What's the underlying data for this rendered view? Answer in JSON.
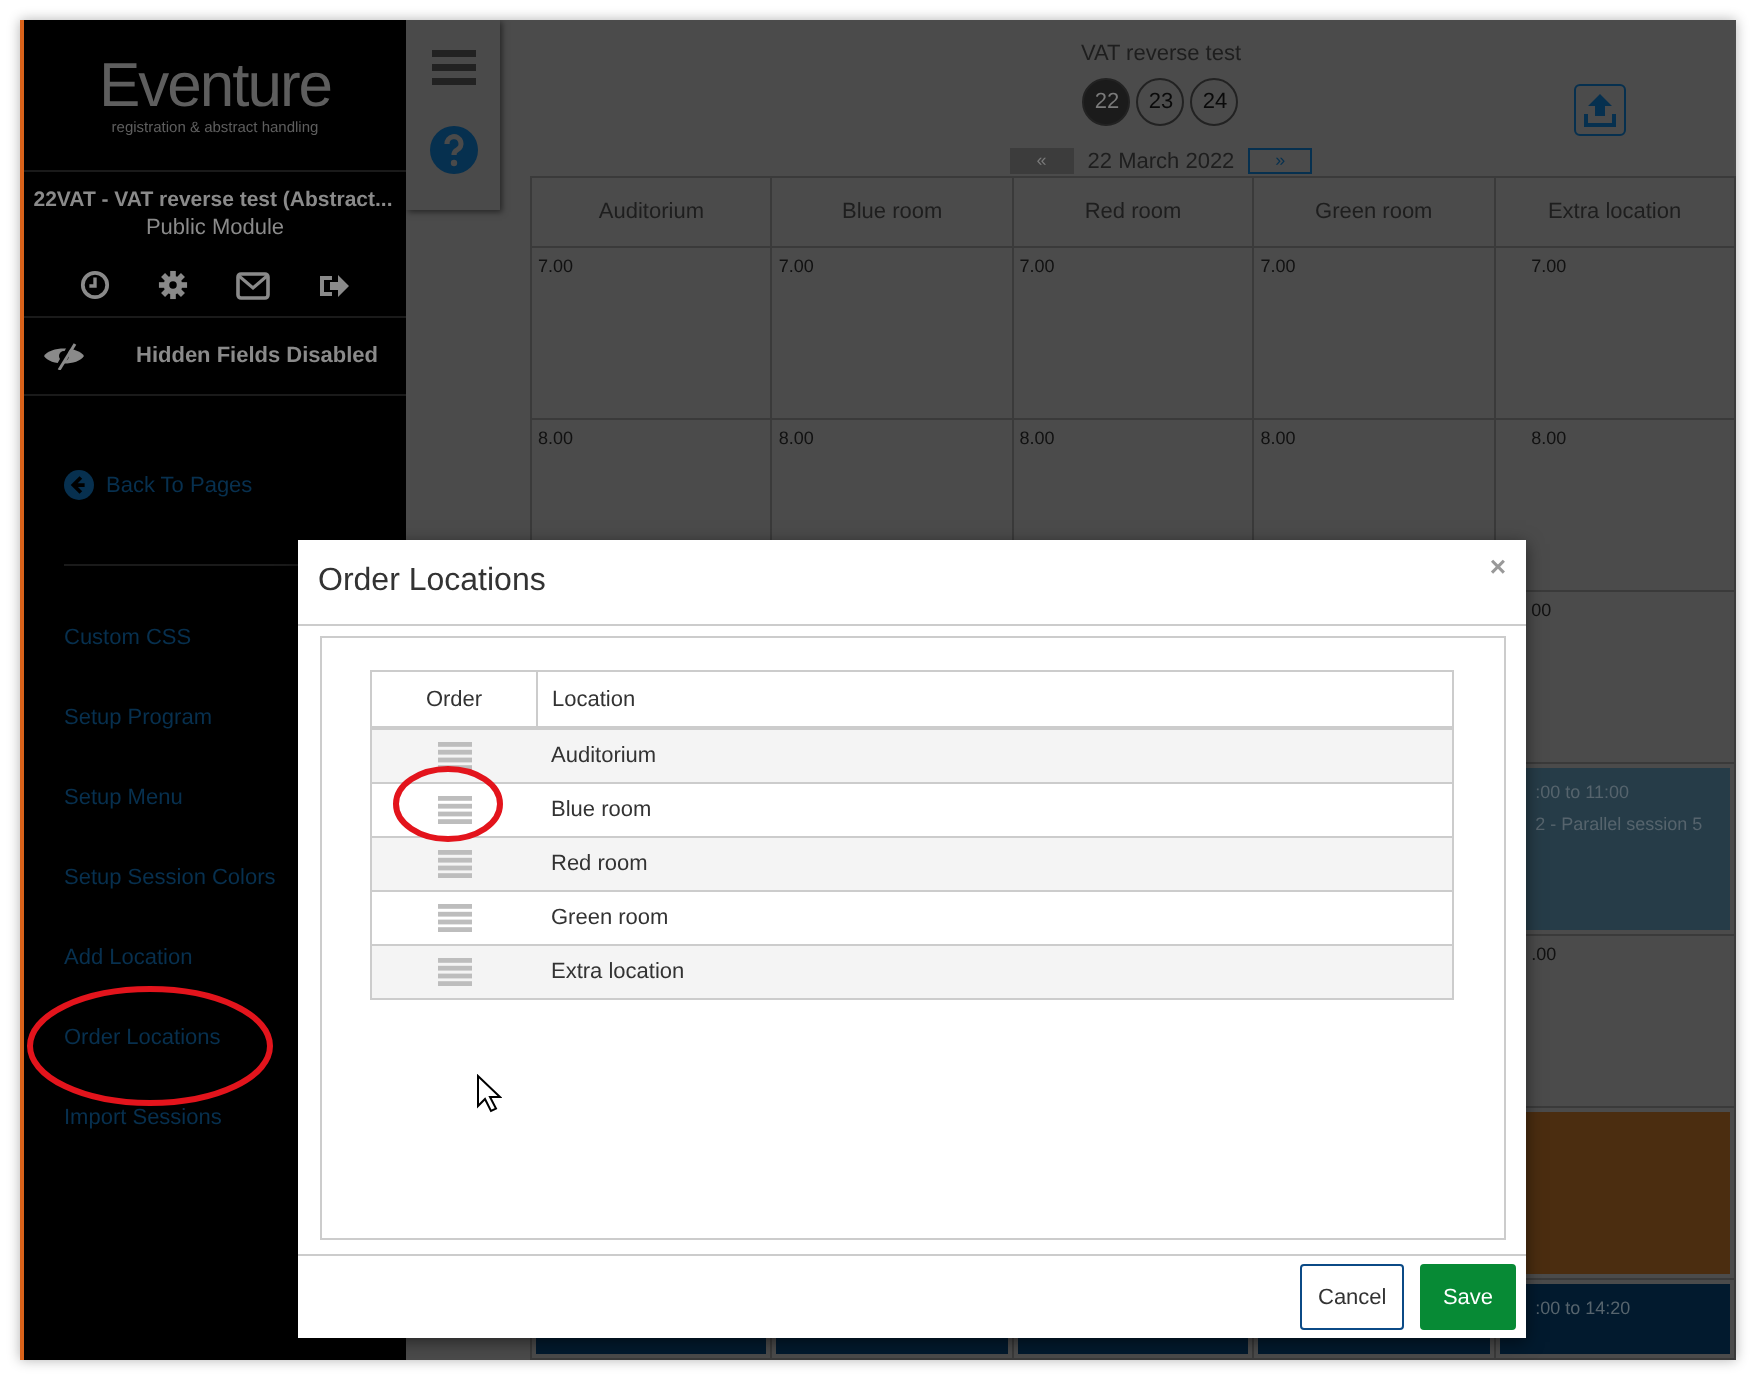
{
  "sidebar": {
    "logo": "Eventure",
    "logo_tagline": "registration & abstract handling",
    "event_title": "22VAT - VAT reverse test (Abstract...",
    "module": "Public Module",
    "hidden_fields": "Hidden Fields Disabled",
    "back_link": "Back To Pages",
    "menu": [
      {
        "label": "Custom CSS"
      },
      {
        "label": "Setup Program"
      },
      {
        "label": "Setup Menu"
      },
      {
        "label": "Setup Session Colors"
      },
      {
        "label": "Add Location"
      },
      {
        "label": "Order Locations"
      },
      {
        "label": "Import Sessions"
      }
    ]
  },
  "calendar": {
    "title": "VAT reverse test",
    "days": [
      {
        "label": "22",
        "selected": true
      },
      {
        "label": "23",
        "selected": false
      },
      {
        "label": "24",
        "selected": false
      }
    ],
    "prev": {
      "label": "«",
      "disabled": true
    },
    "date": "22 March 2022",
    "next": {
      "label": "»",
      "disabled": false
    },
    "columns": [
      "Auditorium",
      "Blue room",
      "Red room",
      "Green room",
      "Extra location"
    ],
    "rows": [
      {
        "cells": [
          {
            "kind": "time",
            "text": "7.00"
          },
          {
            "kind": "time",
            "text": "7.00"
          },
          {
            "kind": "time",
            "text": "7.00"
          },
          {
            "kind": "time",
            "text": "7.00"
          },
          {
            "kind": "time",
            "text": "7.00"
          }
        ]
      },
      {
        "cells": [
          {
            "kind": "time",
            "text": "8.00"
          },
          {
            "kind": "time",
            "text": "8.00"
          },
          {
            "kind": "time",
            "text": "8.00"
          },
          {
            "kind": "time",
            "text": "8.00"
          },
          {
            "kind": "time",
            "text": "8.00"
          }
        ]
      },
      {
        "cells": [
          {
            "kind": "empty"
          },
          {
            "kind": "empty"
          },
          {
            "kind": "empty"
          },
          {
            "kind": "empty"
          },
          {
            "kind": "time",
            "text": "00"
          }
        ]
      },
      {
        "cells": [
          {
            "kind": "empty"
          },
          {
            "kind": "empty"
          },
          {
            "kind": "empty"
          },
          {
            "kind": "empty"
          },
          {
            "kind": "session",
            "color": "#263c48",
            "time": ":00 to 11:00",
            "title": "2 - Parallel session 5"
          }
        ]
      },
      {
        "cells": [
          {
            "kind": "empty"
          },
          {
            "kind": "empty"
          },
          {
            "kind": "empty"
          },
          {
            "kind": "empty"
          },
          {
            "kind": "time",
            "text": ".00"
          }
        ]
      },
      {
        "cells": [
          {
            "kind": "empty"
          },
          {
            "kind": "empty"
          },
          {
            "kind": "empty"
          },
          {
            "kind": "empty"
          },
          {
            "kind": "session",
            "color": "#4b2d10"
          }
        ]
      },
      {
        "cells": [
          {
            "kind": "session",
            "color": "#021a2e"
          },
          {
            "kind": "session",
            "color": "#021a2e"
          },
          {
            "kind": "session",
            "color": "#021a2e"
          },
          {
            "kind": "session",
            "color": "#021a2e"
          },
          {
            "kind": "session",
            "color": "#021a2e",
            "time": ":00 to 14:20"
          }
        ]
      }
    ]
  },
  "dialog": {
    "title": "Order Locations",
    "close": "×",
    "columns": [
      "Order",
      "Location"
    ],
    "rows": [
      {
        "location": "Auditorium"
      },
      {
        "location": "Blue room"
      },
      {
        "location": "Red room"
      },
      {
        "location": "Green room"
      },
      {
        "location": "Extra location"
      }
    ],
    "buttons": [
      {
        "kind": "secondary",
        "label": "Cancel"
      },
      {
        "kind": "primary",
        "label": "Save"
      }
    ]
  }
}
